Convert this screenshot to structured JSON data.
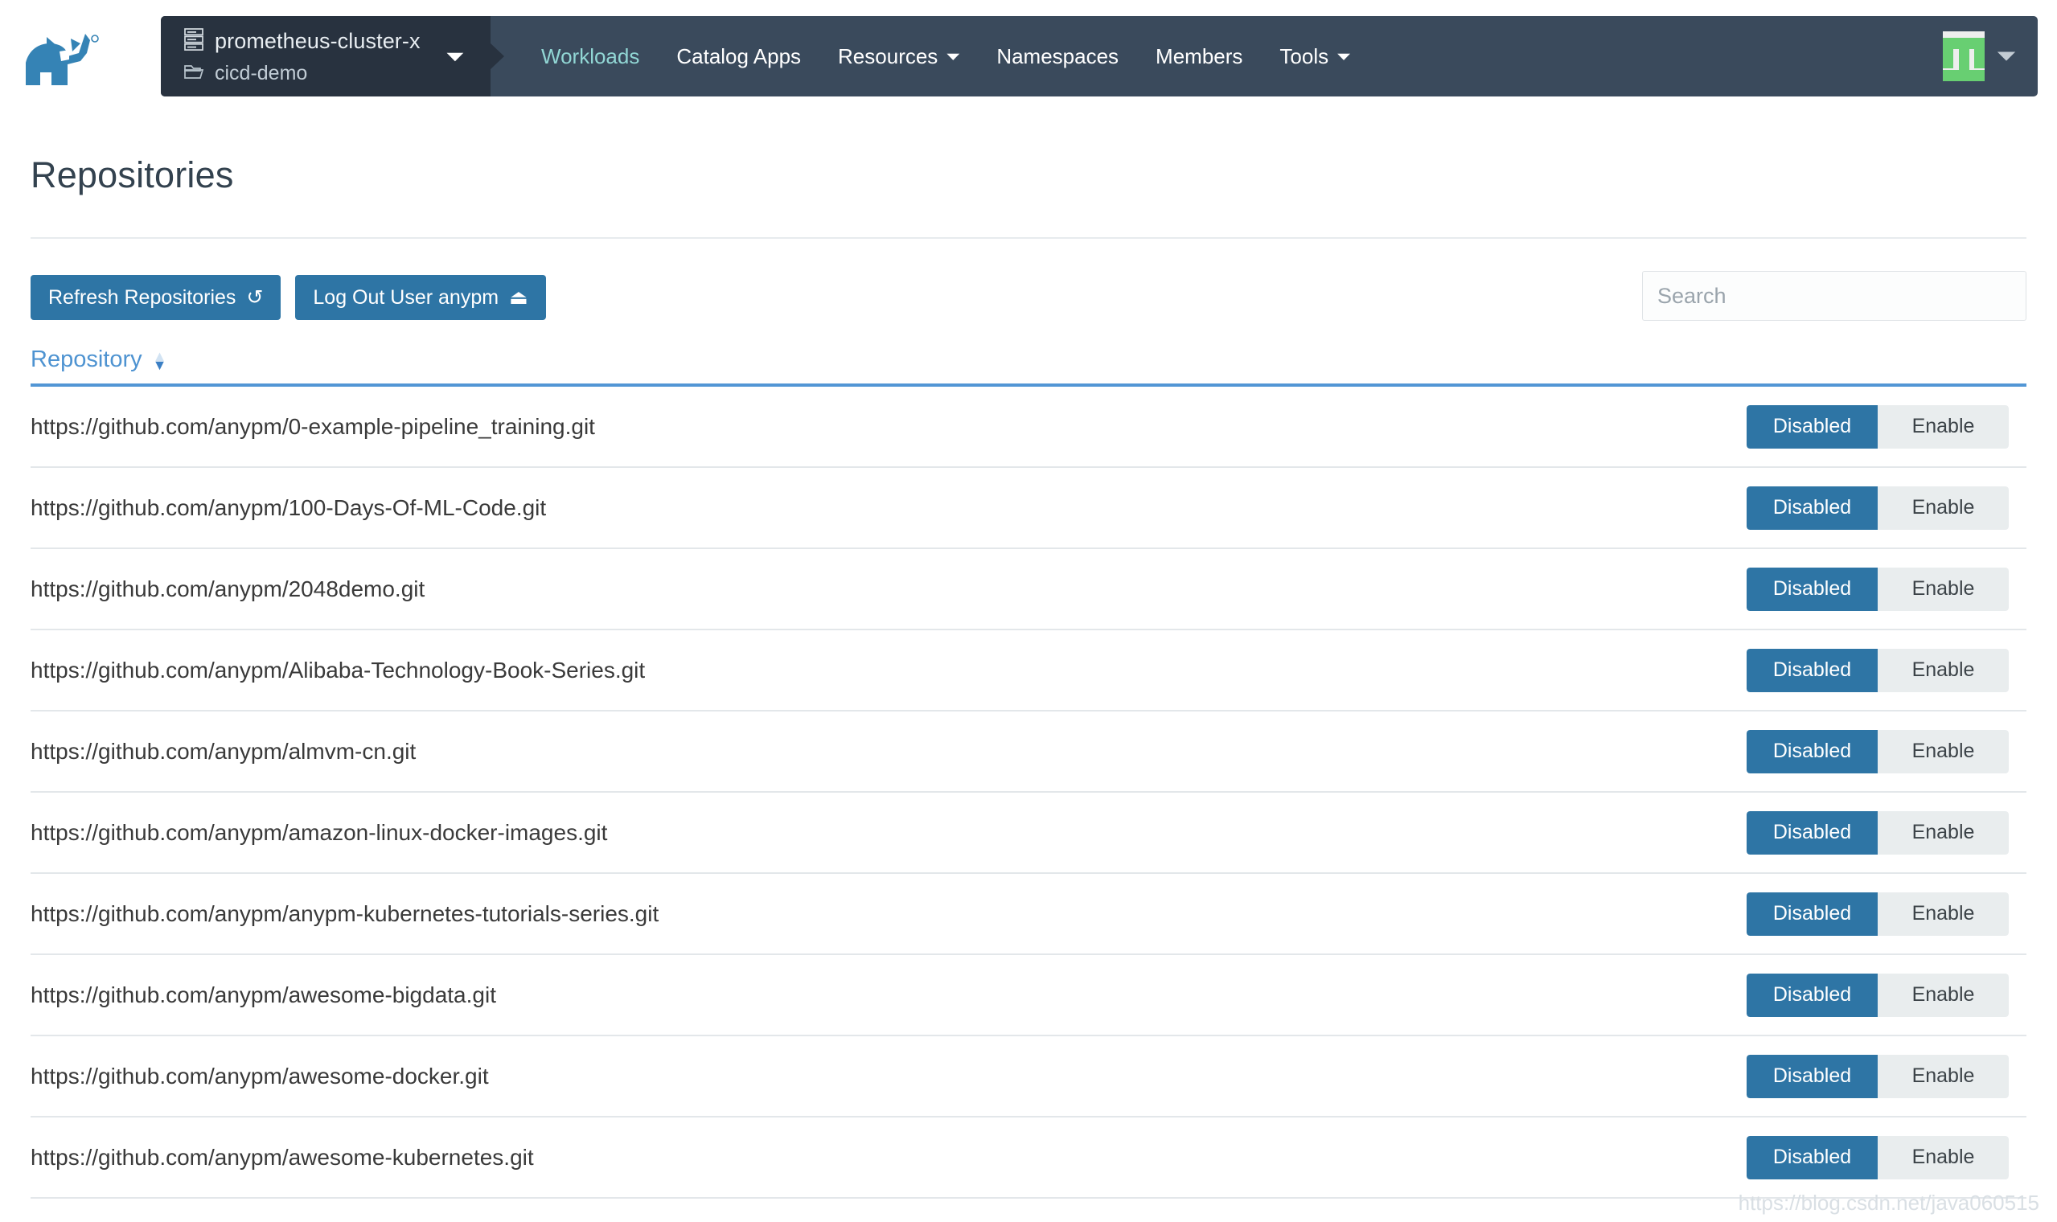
{
  "header": {
    "logo_icon": "rancher-cow-logo",
    "cluster": {
      "cluster_icon": "server-rack-icon",
      "cluster_name": "prometheus-cluster-x",
      "namespace_icon": "folder-icon",
      "namespace_name": "cicd-demo",
      "caret_icon": "chevron-down-icon"
    },
    "nav": [
      {
        "label": "Workloads",
        "active": true,
        "caret": ""
      },
      {
        "label": "Catalog Apps",
        "active": false,
        "caret": ""
      },
      {
        "label": "Resources",
        "active": false,
        "caret": "⌄"
      },
      {
        "label": "Namespaces",
        "active": false,
        "caret": ""
      },
      {
        "label": "Members",
        "active": false,
        "caret": ""
      },
      {
        "label": "Tools",
        "active": false,
        "caret": "⌄"
      }
    ],
    "avatar_icon": "user-identicon-avatar",
    "avatar_caret_icon": "chevron-down-icon"
  },
  "main": {
    "page_title": "Repositories",
    "toolbar": {
      "refresh_label": "Refresh Repositories",
      "refresh_icon": "↺",
      "logout_label": "Log Out User anypm",
      "logout_icon": "⏏",
      "search_placeholder": "Search",
      "search_value": ""
    },
    "table": {
      "column_header": "Repository",
      "sort_icon": "sort-updown-icon",
      "toggle_on_label": "Disabled",
      "toggle_off_label": "Enable",
      "rows": [
        {
          "url": "https://github.com/anypm/0-example-pipeline_training.git",
          "state": "Disabled"
        },
        {
          "url": "https://github.com/anypm/100-Days-Of-ML-Code.git",
          "state": "Disabled"
        },
        {
          "url": "https://github.com/anypm/2048demo.git",
          "state": "Disabled"
        },
        {
          "url": "https://github.com/anypm/Alibaba-Technology-Book-Series.git",
          "state": "Disabled"
        },
        {
          "url": "https://github.com/anypm/almvm-cn.git",
          "state": "Disabled"
        },
        {
          "url": "https://github.com/anypm/amazon-linux-docker-images.git",
          "state": "Disabled"
        },
        {
          "url": "https://github.com/anypm/anypm-kubernetes-tutorials-series.git",
          "state": "Disabled"
        },
        {
          "url": "https://github.com/anypm/awesome-bigdata.git",
          "state": "Disabled"
        },
        {
          "url": "https://github.com/anypm/awesome-docker.git",
          "state": "Disabled"
        },
        {
          "url": "https://github.com/anypm/awesome-kubernetes.git",
          "state": "Disabled"
        }
      ]
    }
  },
  "watermark": "https://blog.csdn.net/java060515",
  "colors": {
    "navbar": "#3a4a5c",
    "selector": "#28323f",
    "accent_blue": "#2e75a5",
    "link_blue": "#4e93d1",
    "active_nav": "#91d6d4",
    "avatar_green": "#68cf72"
  }
}
